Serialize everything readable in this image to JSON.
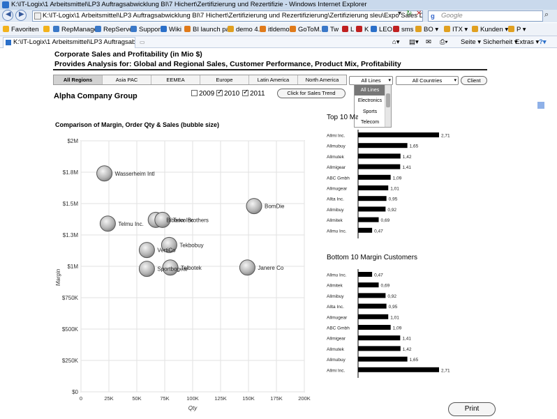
{
  "window": {
    "title": "K:\\IT-Logix\\1 Arbeitsmittel\\LP3 Auftragsabwicklung BI\\7 Hichert\\Zertifizierung und Rezertifizie - Windows Internet Explorer",
    "address": "K:\\IT-Logix\\1 Arbeitsmittel\\LP3 Auftragsabwicklung BI\\7 Hichert\\Zertifizierung und Rezertifizierung\\Zertifizierung sleu\\Expo Sales Dashboard DSG ITX H",
    "search_placeholder": "Google",
    "tab_title": "K:\\IT-Logix\\1 Arbeitsmittel\\LP3 Auftragsabwicklu...",
    "favorites": [
      "Favoriten",
      "RepManager",
      "RepServer",
      "Support",
      "Wiki",
      "BI launch pad",
      "demo 4.0",
      "itldemo",
      "GoToM..",
      "Tw",
      "L",
      "K",
      "LEO",
      "sms",
      "BO ▾",
      "ITX ▾",
      "Kunden ▾",
      "P ▾"
    ],
    "tab_tools": [
      "Seite ▾",
      "Sicherheit ▾",
      "Extras ▾"
    ]
  },
  "dashboard": {
    "title": "Corporate Sales and Profitability (in Mio $)",
    "subtitle": "Provides Analysis for: Global and Regional Sales, Customer Performance, Product Mix, Profitability",
    "regions": [
      "All Regions",
      "Asia PAC",
      "EEMEA",
      "Europe",
      "Latin America",
      "North America"
    ],
    "active_region": 0,
    "lines_select": "All Lines",
    "lines_options": [
      "All Lines",
      "Electronics",
      "Sports",
      "Telecom"
    ],
    "countries_select": "All Countries",
    "client_button": "Client",
    "company": "Alpha Company Group",
    "years": [
      {
        "label": "2009",
        "checked": false
      },
      {
        "label": "2010",
        "checked": true
      },
      {
        "label": "2011",
        "checked": true
      }
    ],
    "sales_trend_button": "Click for Sales Trend",
    "print_button": "Print"
  },
  "chart_data": [
    {
      "type": "scatter",
      "title": "Comparison of Margin, Order Qty & Sales (bubble size)",
      "xlabel": "Qty",
      "ylabel": "Margin",
      "xlim": [
        0,
        200000
      ],
      "ylim": [
        0,
        2000000
      ],
      "x_ticks": [
        "0",
        "25K",
        "50K",
        "75K",
        "100K",
        "125K",
        "150K",
        "175K",
        "200K"
      ],
      "y_ticks": [
        "$0",
        "$250K",
        "$500K",
        "$750K",
        "$1M",
        "$1.3M",
        "$1.5M",
        "$1.8M",
        "$2M"
      ],
      "grid": true,
      "points": [
        {
          "label": "Wasserheim Intl",
          "x": 21000,
          "y": 1740000
        },
        {
          "label": "BomDie",
          "x": 155000,
          "y": 1480000
        },
        {
          "label": "Telmu Inc.",
          "x": 24000,
          "y": 1340000
        },
        {
          "label": "Bibbow Inc",
          "x": 67000,
          "y": 1370000
        },
        {
          "label": "Telco Brothers",
          "x": 73000,
          "y": 1370000
        },
        {
          "label": "Tekbobuy",
          "x": 79000,
          "y": 1170000
        },
        {
          "label": "VertiCo",
          "x": 59000,
          "y": 1130000
        },
        {
          "label": "Sportbogear",
          "x": 59000,
          "y": 980000
        },
        {
          "label": "Telbotek",
          "x": 80000,
          "y": 990000
        },
        {
          "label": "Janere Co",
          "x": 149000,
          "y": 990000
        }
      ]
    },
    {
      "type": "bar",
      "title": "Top 10 Margin Customers",
      "categories": [
        "Allmi Inc.",
        "Allmubuy",
        "Allmutek",
        "Allmigear",
        "ABC Gmbh",
        "Allmugear",
        "Allta Inc.",
        "Allmibuy",
        "Allmitek",
        "Allmu Inc."
      ],
      "values": [
        2.71,
        1.65,
        1.42,
        1.41,
        1.09,
        1.01,
        0.95,
        0.92,
        0.69,
        0.47
      ],
      "value_labels": [
        "2,71",
        "1,65",
        "1,42",
        "1,41",
        "1,09",
        "1,01",
        "0,95",
        "0,92",
        "0,69",
        "0,47"
      ]
    },
    {
      "type": "bar",
      "title": "Bottom 10 Margin Customers",
      "categories": [
        "Allmu Inc.",
        "Allmitek",
        "Allmibuy",
        "Allta Inc.",
        "Allmugear",
        "ABC Gmbh",
        "Allmigear",
        "Allmutek",
        "Allmubuy",
        "Allmi Inc."
      ],
      "values": [
        0.47,
        0.69,
        0.92,
        0.95,
        1.01,
        1.09,
        1.41,
        1.42,
        1.65,
        2.71
      ],
      "value_labels": [
        "0,47",
        "0,69",
        "0,92",
        "0,95",
        "1,01",
        "1,09",
        "1,41",
        "1,42",
        "1,65",
        "2,71"
      ]
    }
  ]
}
